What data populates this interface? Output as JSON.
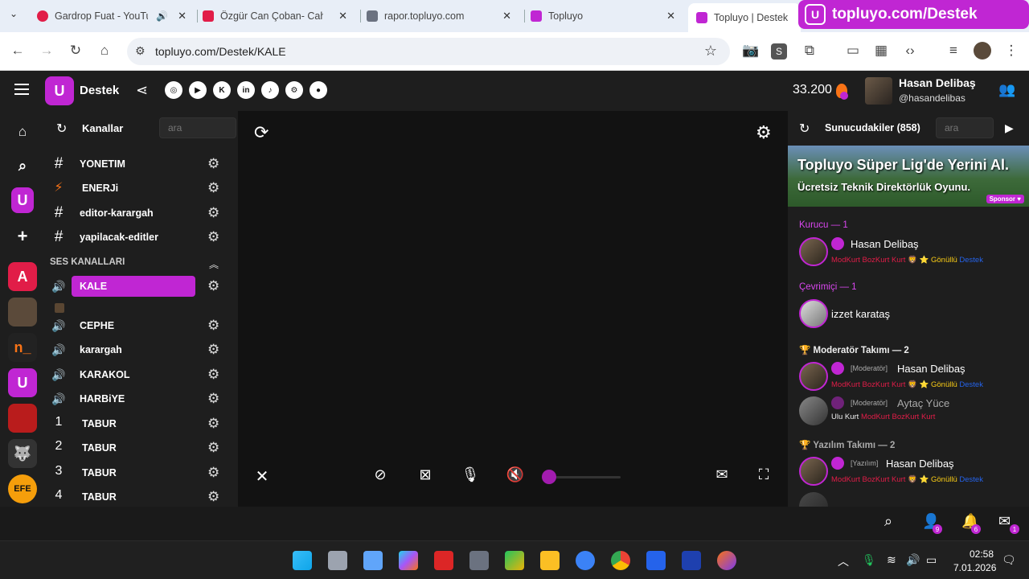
{
  "browser": {
    "tabs": [
      {
        "title": "Gardrop Fuat - YouTube",
        "favicon_color": "#e11d48"
      },
      {
        "title": "Özgür Can Çoban- Cahil",
        "favicon_color": "#e11d48"
      },
      {
        "title": "rapor.topluyo.com",
        "favicon_color": "#6b7280"
      },
      {
        "title": "Topluyo",
        "favicon_color": "#c026d3"
      },
      {
        "title": "Topluyo | Destek",
        "favicon_color": "#c026d3"
      }
    ],
    "overlay_url": "topluyo.com/Destek",
    "url": "topluyo.com/Destek/KALE",
    "ext_letter": "S"
  },
  "header": {
    "brand": "Destek",
    "social_icons": [
      "instagram-icon",
      "youtube-icon",
      "kick-icon",
      "linkedin-icon",
      "tiktok-icon",
      "steam-icon",
      "github-icon"
    ],
    "coins": "33.200",
    "user_name": "Hasan Delibaş",
    "user_handle": "@hasandelibas"
  },
  "channels": {
    "title": "Kanallar",
    "search_placeholder": "ara",
    "text_channels": [
      {
        "symbol": "#",
        "name": "YONETIM"
      },
      {
        "symbol": "⚡",
        "name": "ENERJi"
      },
      {
        "symbol": "#",
        "name": "editor-karargah"
      },
      {
        "symbol": "#",
        "name": "yapilacak-editler"
      }
    ],
    "voice_label": "SES KANALLARI",
    "voice_channels": [
      {
        "symbol": "🔊",
        "name": "KALE"
      },
      {
        "symbol": "🔊",
        "name": "CEPHE"
      },
      {
        "symbol": "🔊",
        "name": "karargah"
      },
      {
        "symbol": "🔊",
        "name": "KARAKOL"
      },
      {
        "symbol": "🔊",
        "name": "HARBiYE"
      },
      {
        "symbol": "1",
        "name": "TABUR"
      },
      {
        "symbol": "2",
        "name": "TABUR"
      },
      {
        "symbol": "3",
        "name": "TABUR"
      },
      {
        "symbol": "4",
        "name": "TABUR"
      }
    ]
  },
  "members": {
    "title": "Sunucudakiler (858)",
    "search_placeholder": "ara",
    "sponsor_title": "Topluyo Süper Lig'de Yerini Al.",
    "sponsor_sub": "Ücretsiz Teknik Direktörlük Oyunu.",
    "sponsor_badge": "Sponsor ♥",
    "groups": {
      "kurucu": "Kurucu — 1",
      "cevrimici": "Çevrimiçi — 1",
      "moderator": "Moderatör Takımı — 2",
      "yazilim": "Yazılım Takımı — 2"
    },
    "m1_name": "Hasan Delibaş",
    "m2_name": "izzet karataş",
    "m3_role": "[Moderatör]",
    "m3_name": "Hasan Delibaş",
    "m4_role": "[Moderatör]",
    "m4_name": "Aytaç Yüce",
    "m5_role": "[Yazılım]",
    "m5_name": "Hasan Delibaş",
    "tag_modkurt": "ModKurt BozKurt Kurt",
    "tag_gonullu": "⭐ Gönüllü",
    "tag_blue": "Destek",
    "tag_ulu": "Ulu Kurt",
    "tag_modkurt2": "ModKurt BozKurt Kurt"
  },
  "bottom_badges": {
    "users": "9",
    "bell": "6",
    "mail": "1"
  },
  "taskbar": {
    "time": "02:58",
    "date": "7.01.2026"
  }
}
